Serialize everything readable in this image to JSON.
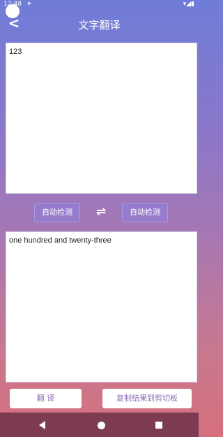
{
  "status_bar": {
    "time": "12:48",
    "notification_icon": "notification-icon",
    "right_icons": "▾◢▮"
  },
  "header": {
    "back_glyph": "<",
    "title": "文字翻译"
  },
  "input": {
    "text": "123"
  },
  "languages": {
    "source": "自动检测",
    "swap_glyph": "⇌",
    "target": "自动检测"
  },
  "output": {
    "text": "one hundred and twenty-three"
  },
  "actions": {
    "translate_label": "翻 译",
    "copy_label": "复制结果到剪切板"
  },
  "colors": {
    "gradient_top": "#6f7dd8",
    "gradient_bottom": "#d6707e",
    "nav_bar": "#7d3b52",
    "button_text": "#8c6fb3"
  }
}
